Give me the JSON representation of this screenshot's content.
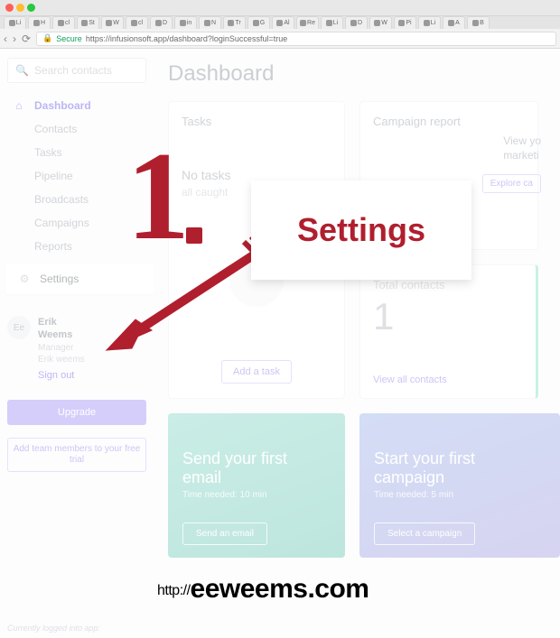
{
  "browser": {
    "tabs": [
      "Li",
      "H",
      "cl",
      "St",
      "W",
      "cl",
      "D",
      "in",
      "N",
      "Tr",
      "G",
      "Al",
      "Re",
      "Li",
      "D",
      "W",
      "Pi",
      "Li",
      "A",
      "B"
    ],
    "secure_label": "Secure",
    "url": "https://infusionsoft.app/dashboard?loginSuccessful=true"
  },
  "sidebar": {
    "search_placeholder": "Search contacts",
    "items": [
      {
        "label": "Dashboard",
        "icon": "home"
      },
      {
        "label": "Contacts",
        "icon": ""
      },
      {
        "label": "Tasks",
        "icon": ""
      },
      {
        "label": "Pipeline",
        "icon": ""
      },
      {
        "label": "Broadcasts",
        "icon": ""
      },
      {
        "label": "Campaigns",
        "icon": ""
      },
      {
        "label": "Reports",
        "icon": ""
      },
      {
        "label": "Settings",
        "icon": "gear"
      }
    ],
    "user": {
      "initials": "Ee",
      "name_first": "Erik",
      "name_last": "Weems",
      "role": "Manager",
      "email": "Erik weems",
      "signout": "Sign out"
    },
    "upgrade_label": "Upgrade",
    "add_team_label": "Add team members to your free trial",
    "logged_into_label": "Currently logged into app:"
  },
  "content": {
    "title": "Dashboard",
    "tasks": {
      "title": "Tasks",
      "headline": "No tasks",
      "sub": "all caught",
      "add_label": "Add a task"
    },
    "campaign_report": {
      "title": "Campaign report",
      "view_line1": "View yo",
      "view_line2": "marketi",
      "explore_label": "Explore ca"
    },
    "total_contacts": {
      "title": "Total contacts",
      "value": "1",
      "view_all": "View all contacts"
    },
    "cta_email": {
      "headline": "Send your first email",
      "time": "Time needed: 10 min",
      "button": "Send an email"
    },
    "cta_campaign": {
      "headline": "Start your first campaign",
      "time": "Time needed: 5 min",
      "button": "Select a campaign"
    }
  },
  "annotation": {
    "number": "1",
    "popup": "Settings",
    "watermark_prefix": "http://",
    "watermark_domain": "eeweems.com"
  }
}
